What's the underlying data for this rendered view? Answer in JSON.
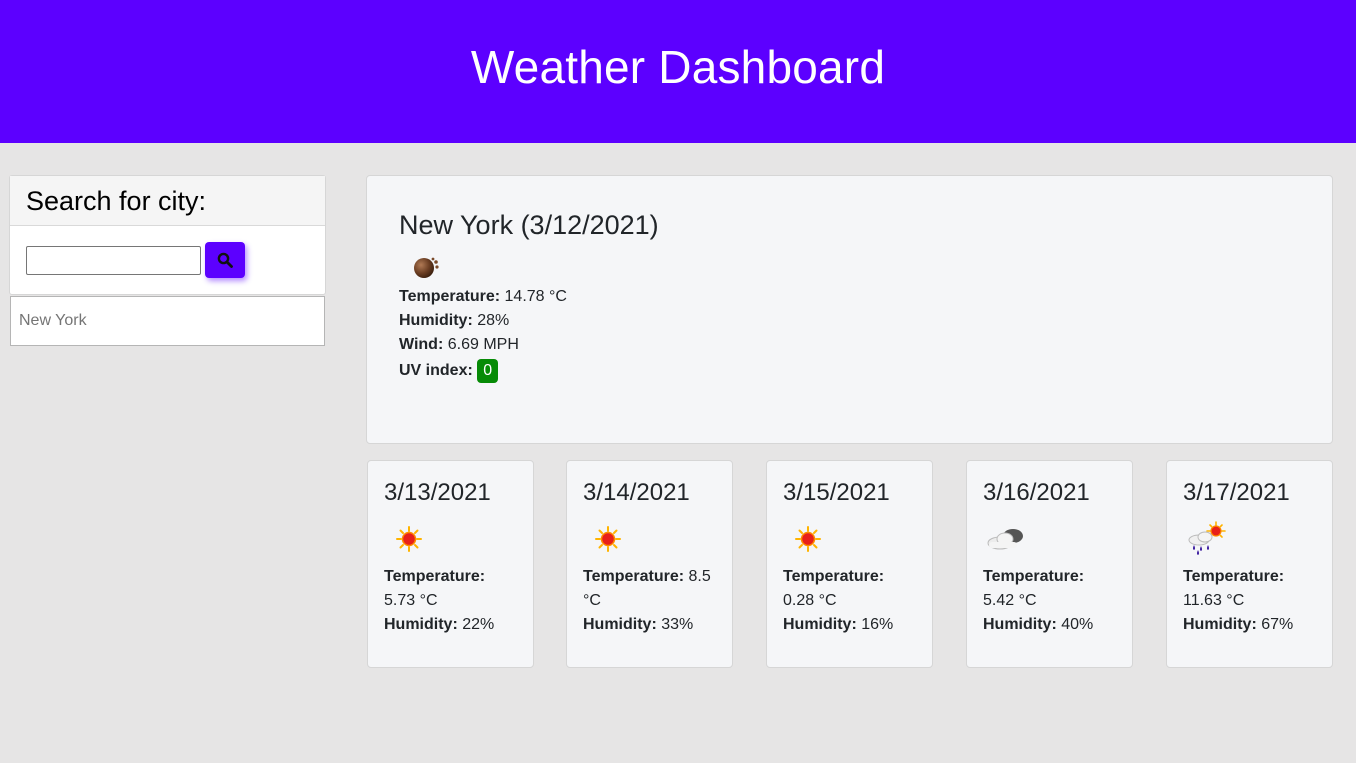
{
  "header": {
    "title": "Weather Dashboard"
  },
  "search": {
    "title": "Search for city:",
    "input_value": "",
    "button_icon": "search-icon",
    "history": [
      "New York"
    ]
  },
  "current": {
    "title": "New York (3/12/2021)",
    "icon": "smoke-icon",
    "temperature_label": "Temperature:",
    "temperature": "14.78 °C",
    "humidity_label": "Humidity:",
    "humidity": "28%",
    "wind_label": "Wind:",
    "wind": "6.69 MPH",
    "uv_label": "UV index:",
    "uv": "0",
    "uv_color": "#078b07"
  },
  "forecast": [
    {
      "date": "3/13/2021",
      "icon": "sun-icon",
      "temperature_label": "Temperature:",
      "temperature": "5.73 °C",
      "humidity_label": "Humidity:",
      "humidity": "22%"
    },
    {
      "date": "3/14/2021",
      "icon": "sun-icon",
      "temperature_label": "Temperature:",
      "temperature": "8.5 °C",
      "humidity_label": "Humidity:",
      "humidity": "33%"
    },
    {
      "date": "3/15/2021",
      "icon": "sun-icon",
      "temperature_label": "Temperature:",
      "temperature": "0.28 °C",
      "humidity_label": "Humidity:",
      "humidity": "16%"
    },
    {
      "date": "3/16/2021",
      "icon": "cloud-icon",
      "temperature_label": "Temperature:",
      "temperature": "5.42 °C",
      "humidity_label": "Humidity:",
      "humidity": "40%"
    },
    {
      "date": "3/17/2021",
      "icon": "rain-sun-icon",
      "temperature_label": "Temperature:",
      "temperature": "11.63 °C",
      "humidity_label": "Humidity:",
      "humidity": "67%"
    }
  ],
  "colors": {
    "brand": "#5c00ff",
    "background": "#e6e5e5"
  }
}
